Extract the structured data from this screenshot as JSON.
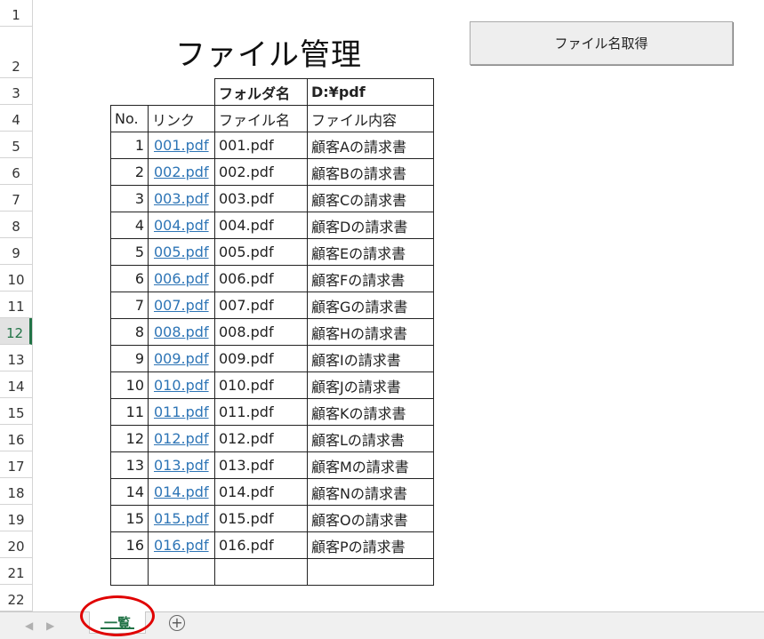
{
  "row_numbers": [
    "1",
    "2",
    "3",
    "4",
    "5",
    "6",
    "7",
    "8",
    "9",
    "10",
    "11",
    "12",
    "13",
    "14",
    "15",
    "16",
    "17",
    "18",
    "19",
    "20",
    "21",
    "22"
  ],
  "title": "ファイル管理",
  "button_label": "ファイル名取得",
  "folder_label": "フォルダ名",
  "folder_value": "D:¥pdf",
  "headers": {
    "no": "No.",
    "link": "リンク",
    "filename": "ファイル名",
    "content": "ファイル内容"
  },
  "rows": [
    {
      "no": "1",
      "link": "001.pdf",
      "file": "001.pdf",
      "content": "顧客Aの請求書"
    },
    {
      "no": "2",
      "link": "002.pdf",
      "file": "002.pdf",
      "content": "顧客Bの請求書"
    },
    {
      "no": "3",
      "link": "003.pdf",
      "file": "003.pdf",
      "content": "顧客Cの請求書"
    },
    {
      "no": "4",
      "link": "004.pdf",
      "file": "004.pdf",
      "content": "顧客Dの請求書"
    },
    {
      "no": "5",
      "link": "005.pdf",
      "file": "005.pdf",
      "content": "顧客Eの請求書"
    },
    {
      "no": "6",
      "link": "006.pdf",
      "file": "006.pdf",
      "content": "顧客Fの請求書"
    },
    {
      "no": "7",
      "link": "007.pdf",
      "file": "007.pdf",
      "content": "顧客Gの請求書"
    },
    {
      "no": "8",
      "link": "008.pdf",
      "file": "008.pdf",
      "content": "顧客Hの請求書"
    },
    {
      "no": "9",
      "link": "009.pdf",
      "file": "009.pdf",
      "content": "顧客Iの請求書"
    },
    {
      "no": "10",
      "link": "010.pdf",
      "file": "010.pdf",
      "content": "顧客Jの請求書"
    },
    {
      "no": "11",
      "link": "011.pdf",
      "file": "011.pdf",
      "content": "顧客Kの請求書"
    },
    {
      "no": "12",
      "link": "012.pdf",
      "file": "012.pdf",
      "content": "顧客Lの請求書"
    },
    {
      "no": "13",
      "link": "013.pdf",
      "file": "013.pdf",
      "content": "顧客Mの請求書"
    },
    {
      "no": "14",
      "link": "014.pdf",
      "file": "014.pdf",
      "content": "顧客Nの請求書"
    },
    {
      "no": "15",
      "link": "015.pdf",
      "file": "015.pdf",
      "content": "顧客Oの請求書"
    },
    {
      "no": "16",
      "link": "016.pdf",
      "file": "016.pdf",
      "content": "顧客Pの請求書"
    }
  ],
  "sheet_tab": "一覧",
  "active_row": "12",
  "colors": {
    "accent": "#217346",
    "link": "#2e75b6",
    "annotation": "#e00000"
  }
}
